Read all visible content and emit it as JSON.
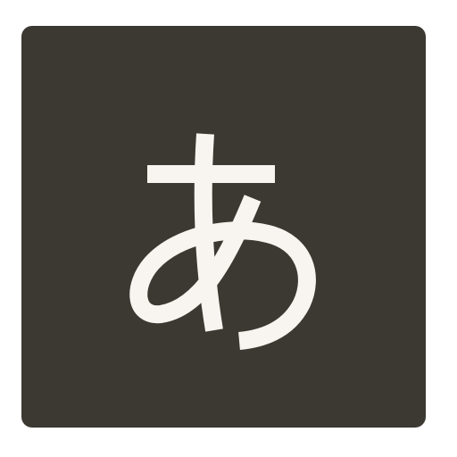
{
  "icon": {
    "name": "hiragana-a-icon",
    "glyph": "あ"
  },
  "colors": {
    "tile_background": "#3c3933",
    "glyph": "#f8f5f0",
    "page_background": "#ffffff"
  }
}
